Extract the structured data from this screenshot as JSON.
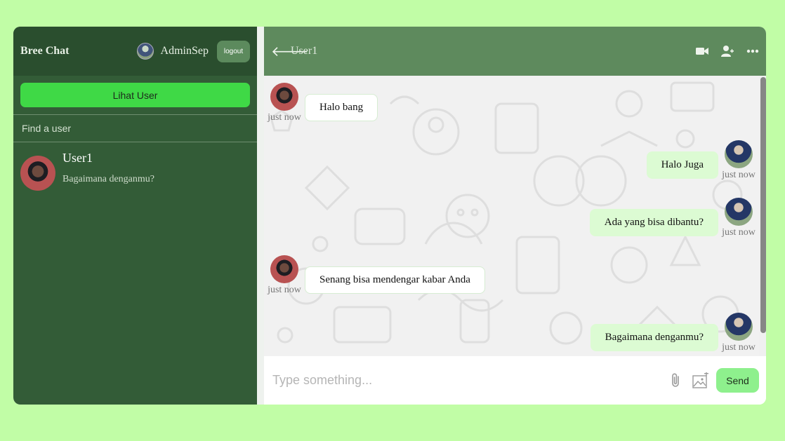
{
  "sidebar": {
    "brand": "Bree Chat",
    "current_user": "AdminSep",
    "logout_label": "logout",
    "lihat_user_label": "Lihat User",
    "find_user_label": "Find a user",
    "chats": [
      {
        "name": "User1",
        "last_message": "Bagaimana denganmu?"
      }
    ]
  },
  "chat": {
    "peer_name": "User1",
    "messages": [
      {
        "from": "User1",
        "text": "Halo bang",
        "time": "just now"
      },
      {
        "from": "AdminSep",
        "text": "Halo Juga",
        "time": "just now"
      },
      {
        "from": "AdminSep",
        "text": "Ada yang bisa dibantu?",
        "time": "just now"
      },
      {
        "from": "User1",
        "text": "Senang bisa mendengar kabar Anda",
        "time": "just now"
      },
      {
        "from": "AdminSep",
        "text": "Bagaimana denganmu?",
        "time": "just now"
      }
    ],
    "input_placeholder": "Type something...",
    "send_label": "Send"
  },
  "icons": [
    "arrow-left-icon",
    "video-camera-icon",
    "add-user-icon",
    "more-icon",
    "paperclip-icon",
    "image-add-icon"
  ],
  "colors": {
    "page_bg": "#c1fda6",
    "sidebar": "#335c37",
    "header": "#5e8a5d",
    "lihat_btn": "#3fd946",
    "send_btn": "#8ef08d",
    "my_bubble": "#dcfbd3"
  }
}
